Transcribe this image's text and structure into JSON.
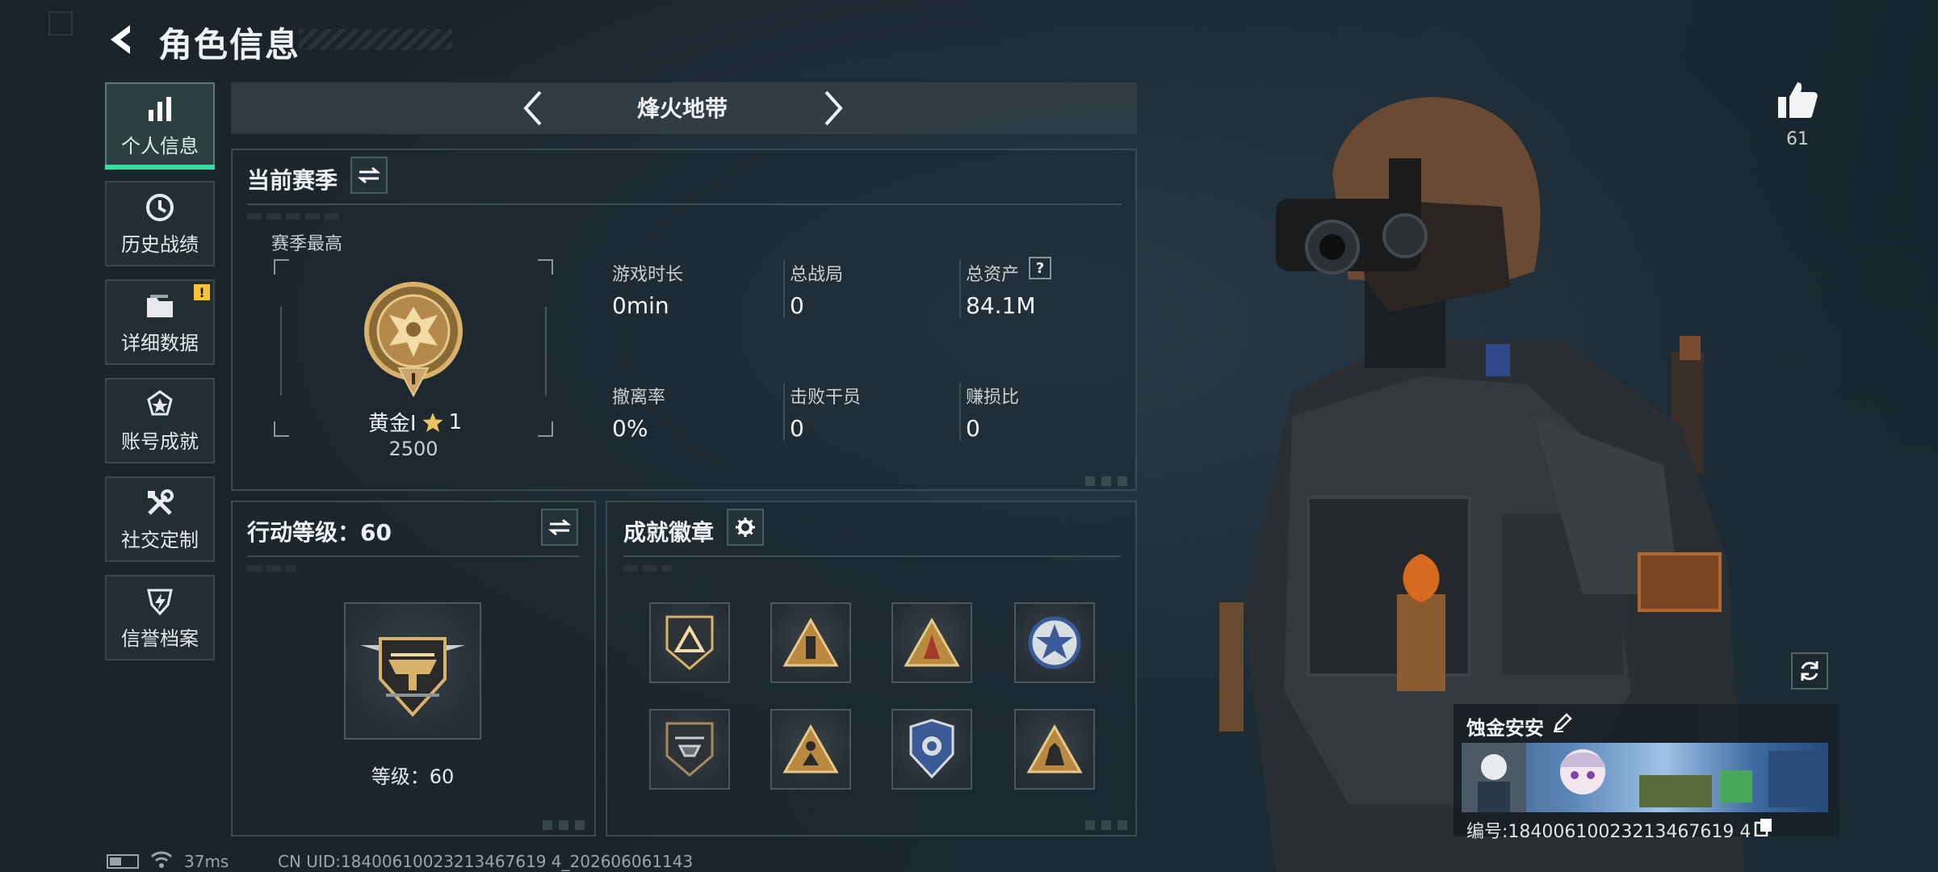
{
  "header": {
    "title": "角色信息"
  },
  "sidebar": {
    "items": [
      {
        "label": "个人信息",
        "icon": "bar-chart-icon",
        "active": true
      },
      {
        "label": "历史战绩",
        "icon": "history-clock-icon"
      },
      {
        "label": "详细数据",
        "icon": "folder-icon",
        "badge": "!"
      },
      {
        "label": "账号成就",
        "icon": "achievement-star-icon"
      },
      {
        "label": "社交定制",
        "icon": "tools-icon"
      },
      {
        "label": "信誉档案",
        "icon": "shield-bolt-icon"
      }
    ]
  },
  "mode": {
    "title": "烽火地带"
  },
  "season": {
    "title": "当前赛季",
    "best_label": "赛季最高",
    "rank_name": "黄金Ⅰ",
    "rank_stars": "1",
    "rank_points": "2500",
    "stats": [
      {
        "label": "游戏时长",
        "value": "0min"
      },
      {
        "label": "总战局",
        "value": "0"
      },
      {
        "label": "总资产",
        "value": "84.1M",
        "help": "?"
      },
      {
        "label": "撤离率",
        "value": "0%"
      },
      {
        "label": "击败干员",
        "value": "0"
      },
      {
        "label": "赚损比",
        "value": "0"
      }
    ]
  },
  "action_level": {
    "title": "行动等级：60",
    "level_text": "等级：60"
  },
  "achievements": {
    "title": "成就徽章",
    "badges": [
      "shield-triangle-badge-icon",
      "triangle-pillar-badge-icon",
      "triangle-fire-badge-icon",
      "star-emblem-badge-icon",
      "helicopter-shield-badge-icon",
      "triangle-figure-badge-icon",
      "police-shield-badge-icon",
      "triangle-horse-badge-icon"
    ]
  },
  "profile": {
    "likes": "61",
    "name": "蚀金安安",
    "id_text": "编号:18400610023213467619 4"
  },
  "footer": {
    "ping": "37ms",
    "uid": "CN UID:18400610023213467619 4_202606061143"
  },
  "colors": {
    "accent": "#2fe1a4",
    "gold": "#d8b26a",
    "alert": "#f5c23a"
  }
}
